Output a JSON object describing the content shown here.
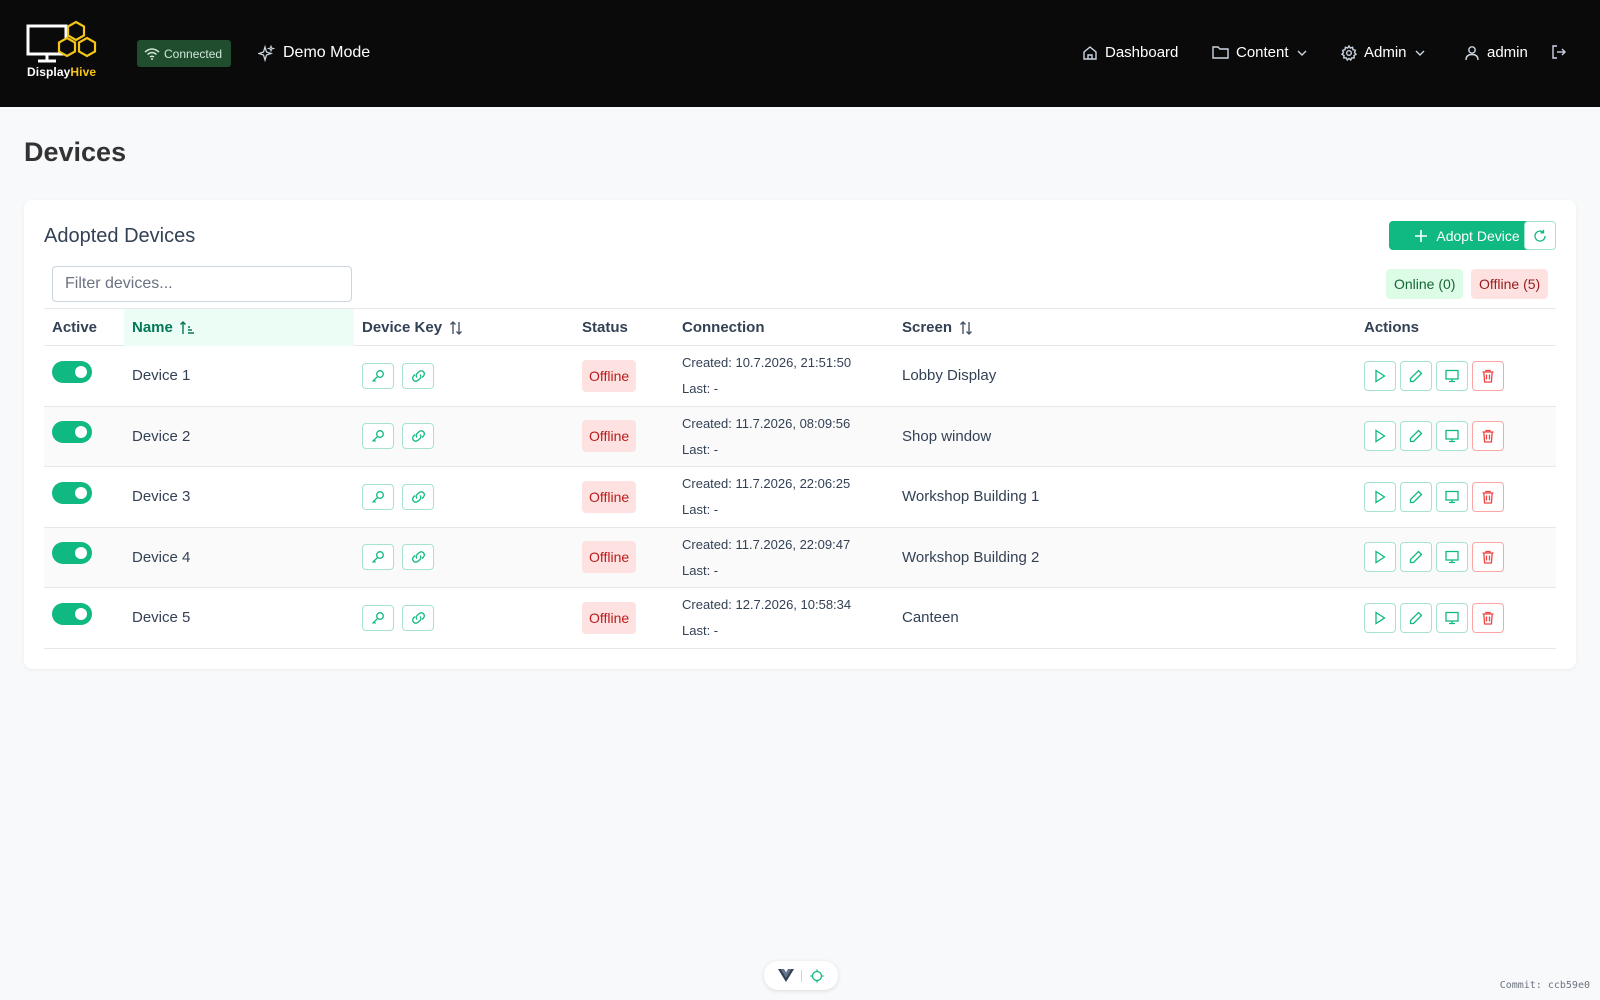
{
  "app": {
    "logo_part1": "Display",
    "logo_part2": "Hive",
    "connection_status": "Connected",
    "demo_mode": "Demo Mode"
  },
  "nav": {
    "dashboard": "Dashboard",
    "content": "Content",
    "admin": "Admin",
    "user": "admin"
  },
  "page": {
    "title": "Devices"
  },
  "card": {
    "title": "Adopted Devices",
    "adopt_label": "Adopt Device",
    "filter_placeholder": "Filter devices...",
    "online_count": "Online (0)",
    "offline_count": "Offline (5)"
  },
  "table": {
    "headers": {
      "active": "Active",
      "name": "Name",
      "device_key": "Device Key",
      "status": "Status",
      "connection": "Connection",
      "screen": "Screen",
      "actions": "Actions"
    },
    "rows": [
      {
        "name": "Device 1",
        "status": "Offline",
        "created": "Created: 10.7.2026, 21:51:50",
        "last": "Last: -",
        "screen": "Lobby Display"
      },
      {
        "name": "Device 2",
        "status": "Offline",
        "created": "Created: 11.7.2026, 08:09:56",
        "last": "Last: -",
        "screen": "Shop window"
      },
      {
        "name": "Device 3",
        "status": "Offline",
        "created": "Created: 11.7.2026, 22:06:25",
        "last": "Last: -",
        "screen": "Workshop Building 1"
      },
      {
        "name": "Device 4",
        "status": "Offline",
        "created": "Created: 11.7.2026, 22:09:47",
        "last": "Last: -",
        "screen": "Workshop Building 2"
      },
      {
        "name": "Device 5",
        "status": "Offline",
        "created": "Created: 12.7.2026, 10:58:34",
        "last": "Last: -",
        "screen": "Canteen"
      }
    ]
  },
  "footer": {
    "commit": "Commit: ccb59e0"
  },
  "colors": {
    "accent": "#10b981",
    "header_bg": "#0a0a0a",
    "offline_bg": "#fee2e2",
    "offline_text": "#b91c1c",
    "logo_yellow": "#f5c518"
  }
}
